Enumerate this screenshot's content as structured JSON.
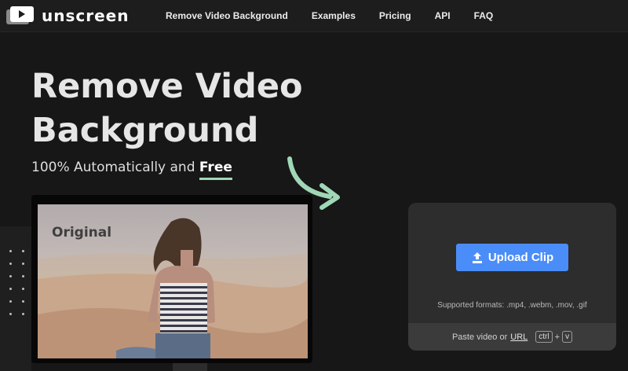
{
  "brand": {
    "name": "unscreen"
  },
  "nav": {
    "links": [
      "Remove Video Background",
      "Examples",
      "Pricing",
      "API",
      "FAQ"
    ]
  },
  "hero": {
    "title_line1": "Remove Video",
    "title_line2": "Background",
    "subtitle_prefix": "100% Automatically and ",
    "subtitle_emphasis": "Free"
  },
  "preview": {
    "label": "Original"
  },
  "upload": {
    "button_label": "Upload Clip",
    "formats_text": "Supported formats: .mp4, .webm, .mov, .gif",
    "paste_text": "Paste video or",
    "url_link": "URL",
    "key_ctrl": "ctrl",
    "key_plus": "+",
    "key_v": "v"
  },
  "colors": {
    "background": "#171717",
    "nav_background": "#1d1d1d",
    "accent_blue": "#4b8df8",
    "accent_green": "#9fd7b7",
    "card_background": "#2d2d2d"
  },
  "icons": {
    "logo": "play-icon",
    "upload": "upload-arrow-icon",
    "arrow": "curved-arrow-icon"
  }
}
